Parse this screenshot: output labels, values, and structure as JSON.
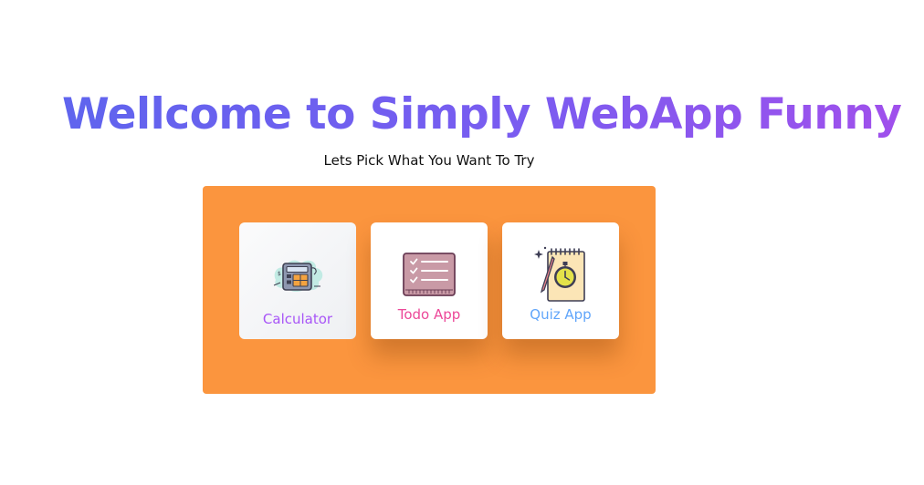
{
  "header": {
    "title": "Wellcome to Simply WebApp Funny",
    "subtitle": "Lets Pick What You Want To Try"
  },
  "apps": [
    {
      "label": "Calculator",
      "icon": "calculator-icon",
      "color": "#a855f7"
    },
    {
      "label": "Todo App",
      "icon": "todo-list-icon",
      "color": "#ec4899"
    },
    {
      "label": "Quiz App",
      "icon": "stopwatch-notebook-icon",
      "color": "#60a5fa"
    }
  ],
  "colors": {
    "panel": "#fb953e",
    "title_gradient_start": "#5f64ee",
    "title_gradient_end": "#a050ec"
  }
}
